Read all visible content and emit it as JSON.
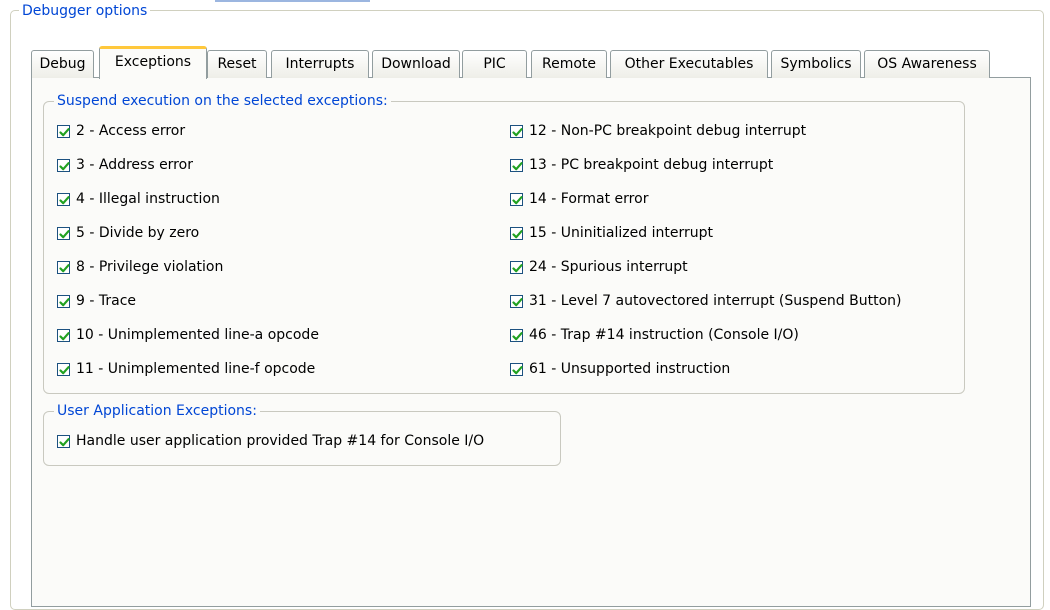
{
  "outer_group": {
    "title": "Debugger options"
  },
  "tabs": [
    {
      "label": "Debug",
      "active": false
    },
    {
      "label": "Exceptions",
      "active": true
    },
    {
      "label": "Reset",
      "active": false
    },
    {
      "label": "Interrupts",
      "active": false
    },
    {
      "label": "Download",
      "active": false
    },
    {
      "label": "PIC",
      "active": false
    },
    {
      "label": "Remote",
      "active": false
    },
    {
      "label": "Other Executables",
      "active": false
    },
    {
      "label": "Symbolics",
      "active": false
    },
    {
      "label": "OS Awareness",
      "active": false
    }
  ],
  "suspend_group": {
    "title": "Suspend execution on the selected exceptions:",
    "left_column": [
      {
        "label": "2 - Access error",
        "checked": true
      },
      {
        "label": "3 - Address error",
        "checked": true
      },
      {
        "label": "4 - Illegal instruction",
        "checked": true
      },
      {
        "label": "5 - Divide by zero",
        "checked": true
      },
      {
        "label": "8 - Privilege violation",
        "checked": true
      },
      {
        "label": "9 - Trace",
        "checked": true
      },
      {
        "label": "10 - Unimplemented line-a opcode",
        "checked": true
      },
      {
        "label": "11 - Unimplemented line-f opcode",
        "checked": true
      }
    ],
    "right_column": [
      {
        "label": "12 - Non-PC breakpoint debug interrupt",
        "checked": true
      },
      {
        "label": "13 - PC breakpoint debug interrupt",
        "checked": true
      },
      {
        "label": "14 - Format error",
        "checked": true
      },
      {
        "label": "15 - Uninitialized interrupt",
        "checked": true
      },
      {
        "label": "24 - Spurious interrupt",
        "checked": true
      },
      {
        "label": "31 - Level 7 autovectored interrupt (Suspend Button)",
        "checked": true
      },
      {
        "label": "46 - Trap #14 instruction (Console I/O)",
        "checked": true
      },
      {
        "label": "61 - Unsupported instruction",
        "checked": true
      }
    ]
  },
  "user_group": {
    "title": "User Application Exceptions:",
    "items": [
      {
        "label": "Handle user application provided Trap #14 for Console I/O",
        "checked": true
      }
    ]
  },
  "colors": {
    "legend_text": "#0046d5",
    "active_tab_accent": "#ffc83c",
    "checkmark": "#21a121",
    "panel_bg": "#fbfbf9"
  }
}
